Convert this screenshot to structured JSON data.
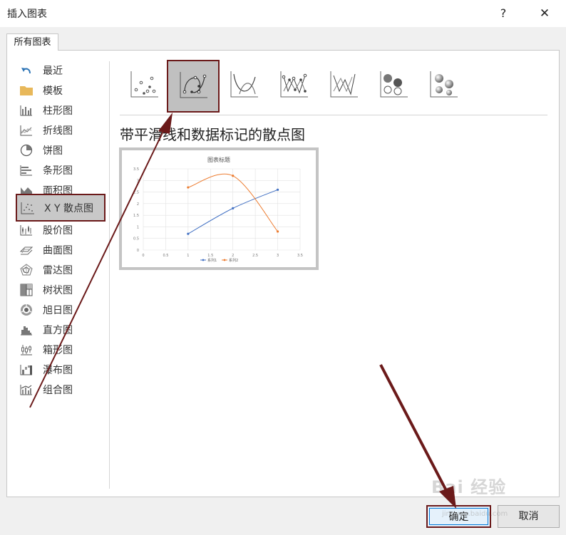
{
  "window": {
    "title": "插入图表",
    "help": "?",
    "close": "✕"
  },
  "tabs": [
    {
      "label": "所有图表"
    }
  ],
  "sidebar": {
    "items": [
      {
        "label": "最近",
        "icon": "recent-icon"
      },
      {
        "label": "模板",
        "icon": "folder-icon"
      },
      {
        "label": "柱形图",
        "icon": "column-chart-icon"
      },
      {
        "label": "折线图",
        "icon": "line-chart-icon"
      },
      {
        "label": "饼图",
        "icon": "pie-chart-icon"
      },
      {
        "label": "条形图",
        "icon": "bar-chart-icon"
      },
      {
        "label": "面积图",
        "icon": "area-chart-icon"
      },
      {
        "label": "X Y 散点图",
        "icon": "scatter-chart-icon"
      },
      {
        "label": "股价图",
        "icon": "stock-chart-icon"
      },
      {
        "label": "曲面图",
        "icon": "surface-chart-icon"
      },
      {
        "label": "雷达图",
        "icon": "radar-chart-icon"
      },
      {
        "label": "树状图",
        "icon": "treemap-chart-icon"
      },
      {
        "label": "旭日图",
        "icon": "sunburst-chart-icon"
      },
      {
        "label": "直方图",
        "icon": "histogram-chart-icon"
      },
      {
        "label": "箱形图",
        "icon": "box-chart-icon"
      },
      {
        "label": "瀑布图",
        "icon": "waterfall-chart-icon"
      },
      {
        "label": "组合图",
        "icon": "combo-chart-icon"
      }
    ],
    "selected_index": 7
  },
  "subtypes": [
    {
      "name": "scatter",
      "icon": "scatter-subtype-icon"
    },
    {
      "name": "scatter-smooth-markers",
      "icon": "scatter-smooth-markers-icon"
    },
    {
      "name": "scatter-smooth",
      "icon": "scatter-smooth-icon"
    },
    {
      "name": "scatter-straight-markers",
      "icon": "scatter-straight-markers-icon"
    },
    {
      "name": "scatter-straight",
      "icon": "scatter-straight-icon"
    },
    {
      "name": "bubble",
      "icon": "bubble-icon"
    },
    {
      "name": "bubble-3d",
      "icon": "bubble-3d-icon"
    }
  ],
  "selected_subtype_index": 1,
  "subtype_title": "带平滑线和数据标记的散点图",
  "chart_data": {
    "type": "scatter",
    "title": "图表标题",
    "xlim": [
      0,
      3.5
    ],
    "ylim": [
      0,
      3.5
    ],
    "x_ticks": [
      "0",
      "0.5",
      "1",
      "1.5",
      "2",
      "2.5",
      "3",
      "3.5"
    ],
    "y_ticks": [
      "0",
      "0.5",
      "1",
      "1.5",
      "2",
      "2.5",
      "3",
      "3.5"
    ],
    "grid": true,
    "legend_position": "bottom",
    "series": [
      {
        "name": "系列1",
        "color": "#4472c4",
        "x": [
          1,
          2,
          3
        ],
        "y": [
          0.7,
          1.8,
          2.6
        ]
      },
      {
        "name": "系列2",
        "color": "#ed7d31",
        "x": [
          1,
          2,
          3
        ],
        "y": [
          2.7,
          3.2,
          0.8
        ]
      }
    ]
  },
  "buttons": {
    "ok": "确定",
    "cancel": "取消"
  },
  "watermark": {
    "main": "Bai 经验",
    "sub": "jingyan.baidu.com"
  },
  "colors": {
    "annotation": "#6b1a1a",
    "accent": "#0078d7"
  }
}
